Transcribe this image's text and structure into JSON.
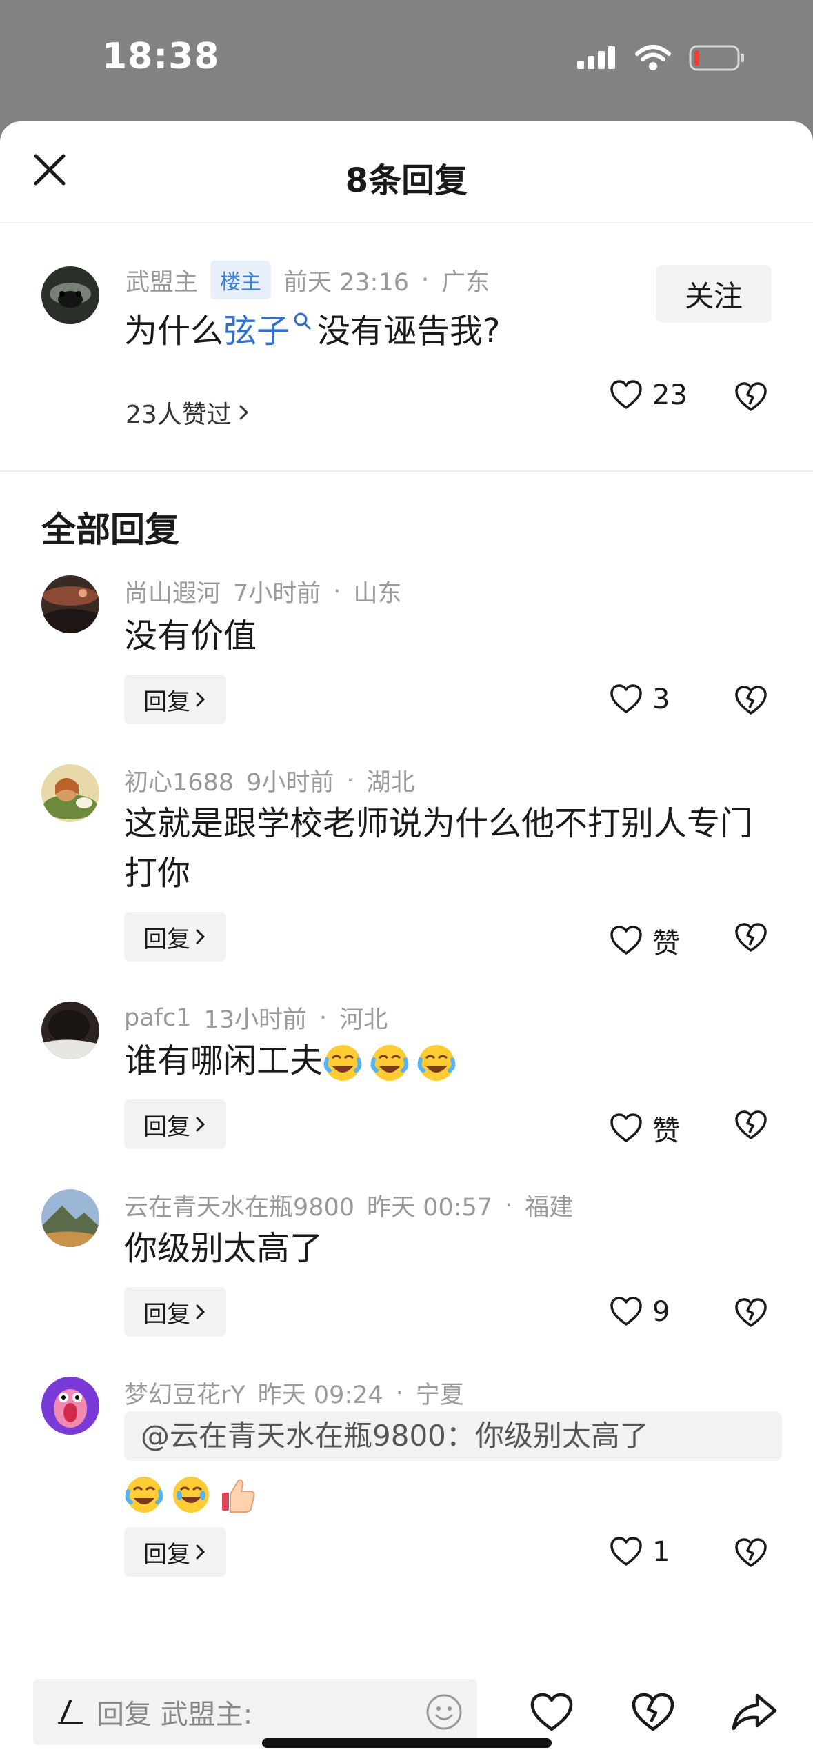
{
  "status_bar": {
    "time": "18:38"
  },
  "header": {
    "title": "8条回复"
  },
  "original_post": {
    "user": "武盟主",
    "badge": "楼主",
    "time": "前天 23:16",
    "location": "广东",
    "follow_label": "关注",
    "text_before": "为什么",
    "link_text": "弦子",
    "text_after": "没有诬告我?",
    "likes_summary": "23人赞过",
    "like_count": "23"
  },
  "section_title": "全部回复",
  "reply_label": "回复",
  "replies": [
    {
      "user": "尚山遐河",
      "time": "7小时前",
      "location": "山东",
      "text": "没有价值",
      "likes": "3"
    },
    {
      "user": "初心1688",
      "time": "9小时前",
      "location": "湖北",
      "text_line1": "这就是跟学校老师说为什么他不打别人专门",
      "text_line2": "打你",
      "likes": "赞"
    },
    {
      "user": "pafc1",
      "time": "13小时前",
      "location": "河北",
      "text": "谁有哪闲工夫",
      "likes": "赞"
    },
    {
      "user": "云在青天水在瓶9800",
      "time": "昨天 00:57",
      "location": "福建",
      "text": "你级别太高了",
      "likes": "9"
    },
    {
      "user": "梦幻豆花rY",
      "time": "昨天 09:24",
      "location": "宁夏",
      "quote": "@云在青天水在瓶9800：你级别太高了",
      "likes": "1"
    }
  ],
  "bottom_bar": {
    "placeholder": "回复 武盟主:"
  },
  "colors": {
    "link": "#2e6fd0",
    "badge_bg": "#e8f1fb",
    "badge_text": "#3b7fd6",
    "status_bg": "#828282"
  }
}
